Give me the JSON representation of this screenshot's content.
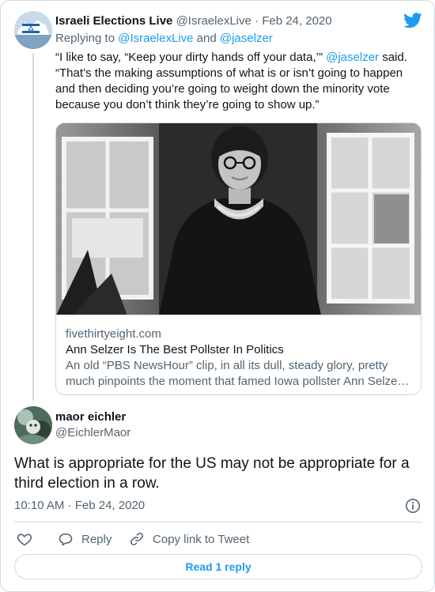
{
  "parent_tweet": {
    "author_name": "Israeli Elections Live",
    "author_handle": "@IsraelexLive",
    "separator": "·",
    "date": "Feb 24, 2020",
    "replying_label": "Replying to",
    "replying_to_1": "@IsraelexLive",
    "replying_and": "and",
    "replying_to_2": "@jaselzer",
    "text_part1": "“I like to say, “Keep your dirty hands off your data,’”",
    "text_mention": "@jaselzer",
    "text_part2": "said. “That’s the making assumptions of what is or isn’t going to happen and then deciding you’re going to weight down the minority vote because you don’t think they’re going to show up.”",
    "link_card": {
      "domain": "fivethirtyeight.com",
      "title": "Ann Selzer Is The Best Pollster In Politics",
      "description": "An old “PBS NewsHour” clip, in all its dull, steady glory, pretty much pinpoints the moment that famed Iowa pollster Ann Selze…"
    }
  },
  "main_tweet": {
    "author_name": "maor eichler",
    "author_handle": "@EichlerMaor",
    "text": "What is appropriate for the US may not be appropriate for a third election in a row.",
    "time": "10:10 AM",
    "separator": "·",
    "date": "Feb 24, 2020"
  },
  "actions": {
    "like_label": "",
    "reply_label": "Reply",
    "copy_link_label": "Copy link to Tweet"
  },
  "read_replies_label": "Read 1 reply",
  "icons": {
    "brand": "twitter-bird-icon",
    "like": "heart-icon",
    "reply": "reply-bubble-icon",
    "copy": "link-icon",
    "info": "info-icon"
  },
  "colors": {
    "accent": "#1d9bf0",
    "text": "#0f1419",
    "muted": "#536471",
    "border": "#cfd9de"
  }
}
